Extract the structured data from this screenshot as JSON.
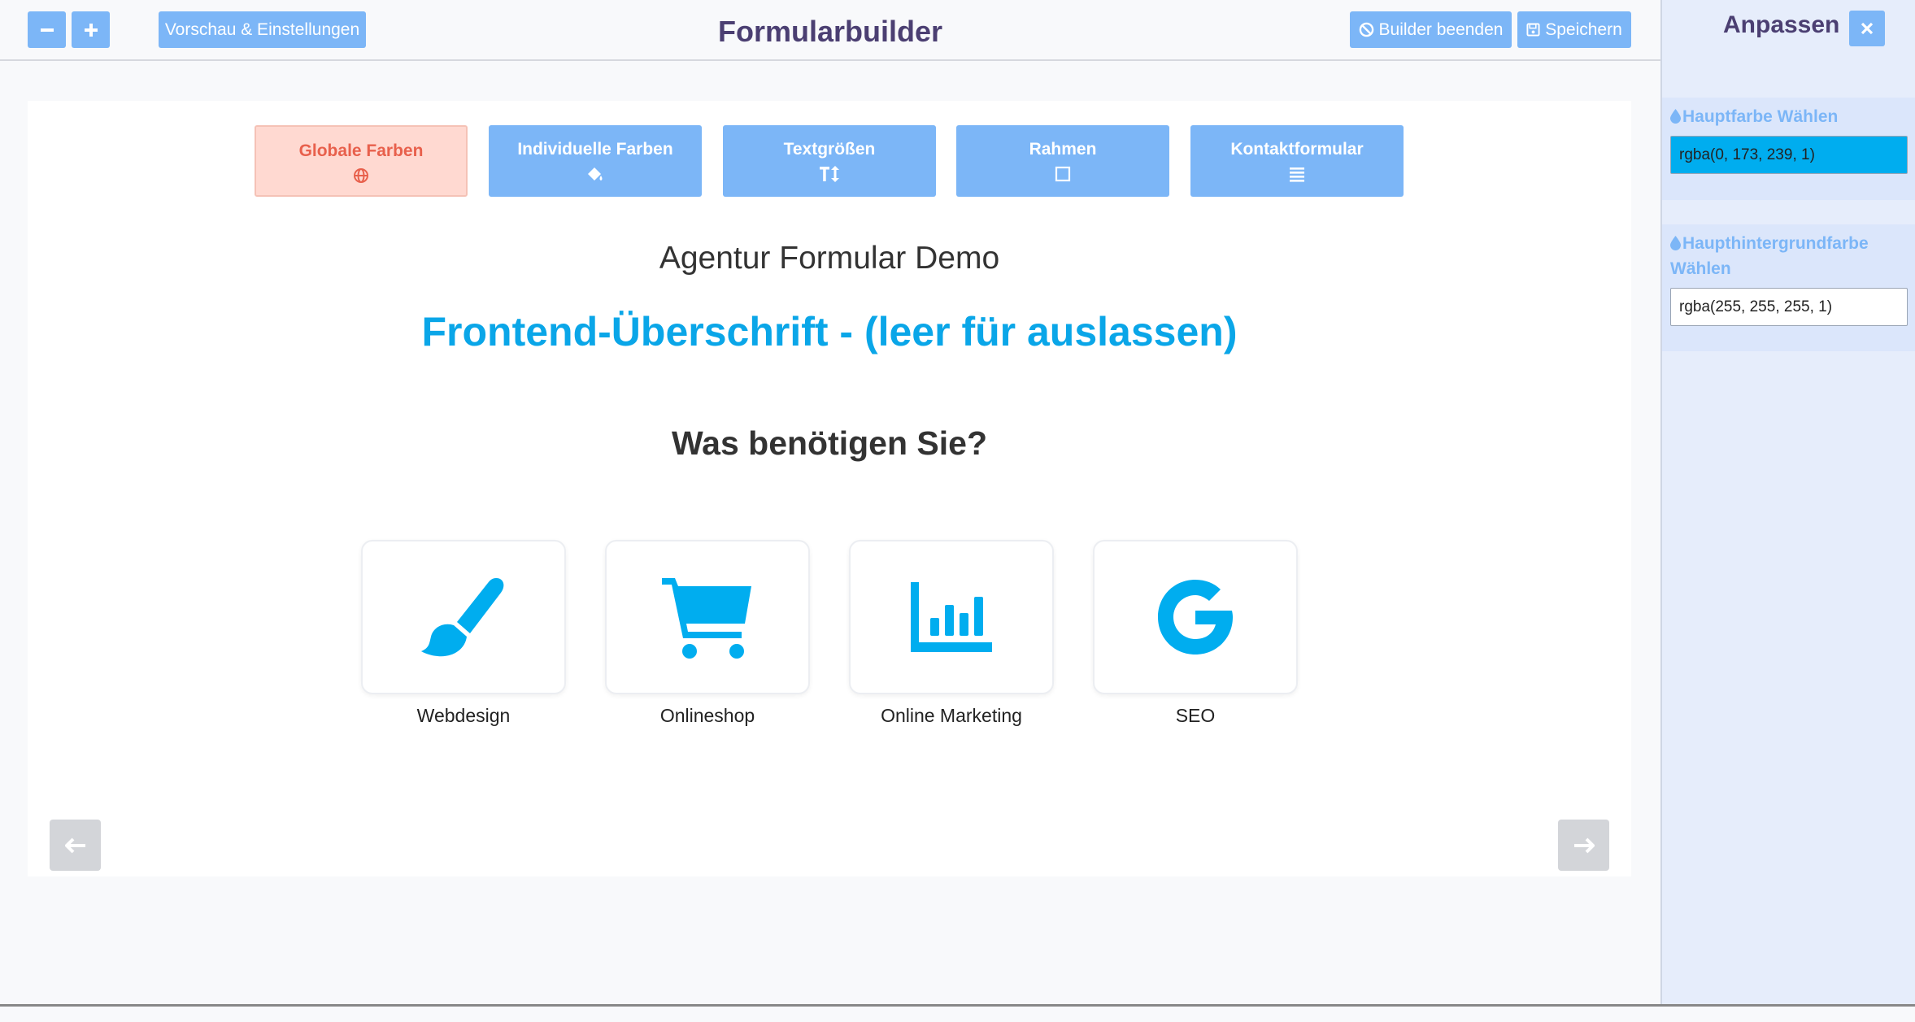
{
  "topbar": {
    "zoom_out_icon": "minus-icon",
    "zoom_in_icon": "plus-icon",
    "preview_label": "Vorschau & Einstellungen",
    "title": "Formularbuilder",
    "exit_label": "Builder beenden",
    "save_label": "Speichern"
  },
  "sidebar": {
    "title": "Anpassen",
    "close_icon": "close-icon",
    "fields": [
      {
        "label": "Hauptfarbe Wählen",
        "value": "rgba(0, 173, 239, 1)",
        "swatch": "#00adef"
      },
      {
        "label": "Haupthintergrundfarbe Wählen",
        "value": "rgba(255, 255, 255, 1)",
        "swatch": "#ffffff"
      }
    ]
  },
  "tabs": [
    {
      "label": "Globale Farben",
      "icon": "globe-icon",
      "active": true
    },
    {
      "label": "Individuelle Farben",
      "icon": "paint-bucket-icon",
      "active": false
    },
    {
      "label": "Textgrößen",
      "icon": "text-height-icon",
      "active": false
    },
    {
      "label": "Rahmen",
      "icon": "square-icon",
      "active": false
    },
    {
      "label": "Kontaktformular",
      "icon": "list-icon",
      "active": false
    }
  ],
  "form": {
    "demo_title": "Agentur Formular Demo",
    "frontend_heading": "Frontend-Überschrift - (leer für auslassen)",
    "question": "Was benötigen Sie?",
    "options": [
      {
        "label": "Webdesign",
        "icon": "paintbrush-icon"
      },
      {
        "label": "Onlineshop",
        "icon": "shopping-cart-icon"
      },
      {
        "label": "Online Marketing",
        "icon": "bar-chart-icon"
      },
      {
        "label": "SEO",
        "icon": "google-icon"
      }
    ],
    "prev_icon": "arrow-left-icon",
    "next_icon": "arrow-right-icon"
  },
  "colors": {
    "accent": "#00adef",
    "button": "#7cb6f7",
    "title": "#4b3f72",
    "active_tab_bg": "#ffd9d1",
    "active_tab_text": "#e8604c"
  }
}
